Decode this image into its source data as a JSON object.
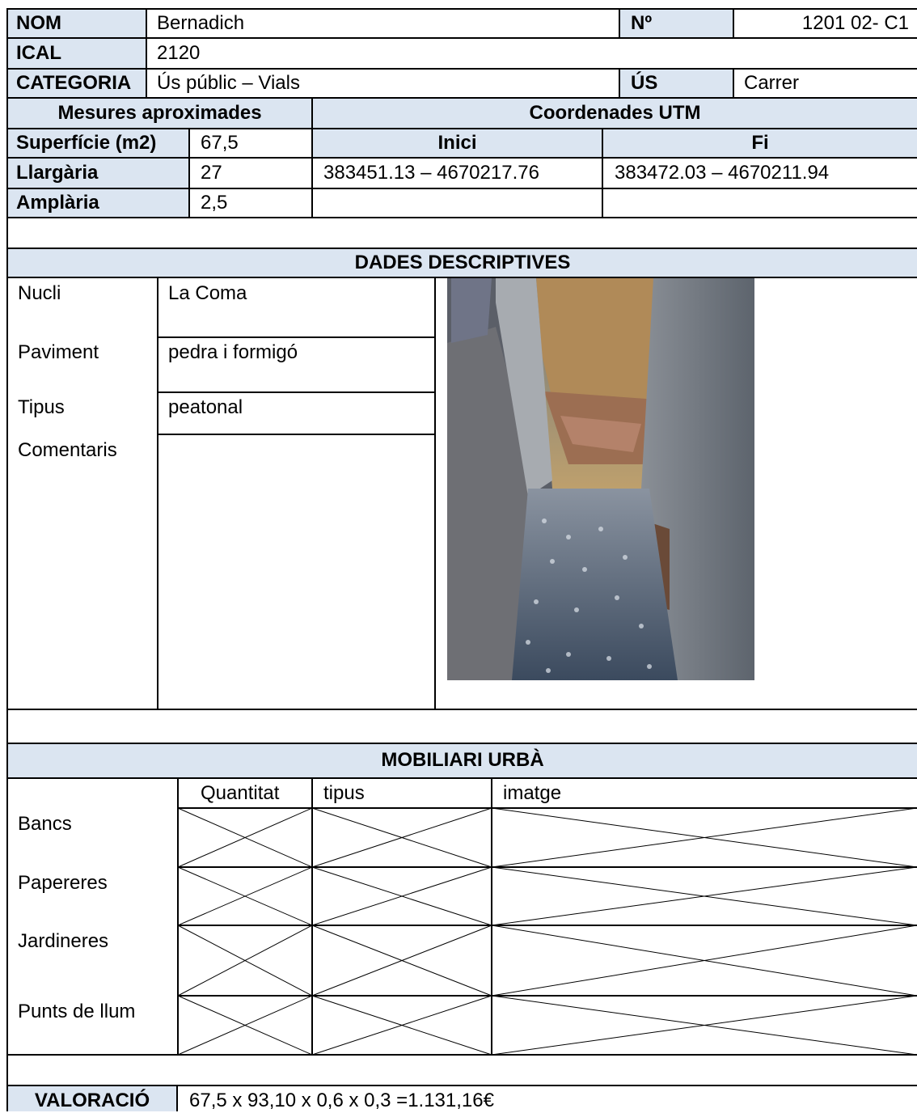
{
  "header": {
    "nom_label": "NOM",
    "nom_value": "Bernadich",
    "num_label": "Nº",
    "num_value": "1201 02- C1",
    "ical_label": "ICAL",
    "ical_value": "2120",
    "categoria_label": "CATEGORIA",
    "categoria_value": "Ús públic – Vials",
    "us_label": "ÚS",
    "us_value": "Carrer"
  },
  "mesures": {
    "title": "Mesures aproximades",
    "superficie_label": "Superfície (m2)",
    "superficie_value": "67,5",
    "llargaria_label": "Llargària",
    "llargaria_value": "27",
    "amplaria_label": "Amplària",
    "amplaria_value": "2,5"
  },
  "utm": {
    "title": "Coordenades UTM",
    "inici_label": "Inici",
    "fi_label": "Fi",
    "inici_value": "383451.13 – 4670217.76",
    "fi_value": "383472.03 – 4670211.94"
  },
  "descriptives": {
    "title": "DADES DESCRIPTIVES",
    "nucli_label": "Nucli",
    "nucli_value": "La Coma",
    "paviment_label": "Paviment",
    "paviment_value": "pedra i formigó",
    "tipus_label": "Tipus",
    "tipus_value": "peatonal",
    "comentaris_label": "Comentaris",
    "comentaris_value": ""
  },
  "mobiliari": {
    "title": "MOBILIARI URBÀ",
    "col_quantitat": "Quantitat",
    "col_tipus": "tipus",
    "col_imatge": "imatge",
    "rows": [
      "Bancs",
      "Papereres",
      "Jardineres",
      "Punts de llum"
    ]
  },
  "valoracio": {
    "label": "VALORACIÓ",
    "value": "67,5 x 93,10 x 0,6 x 0,3 =1.131,16€"
  },
  "colors": {
    "header_fill": "#dbe5f1",
    "rule": "#000000"
  }
}
